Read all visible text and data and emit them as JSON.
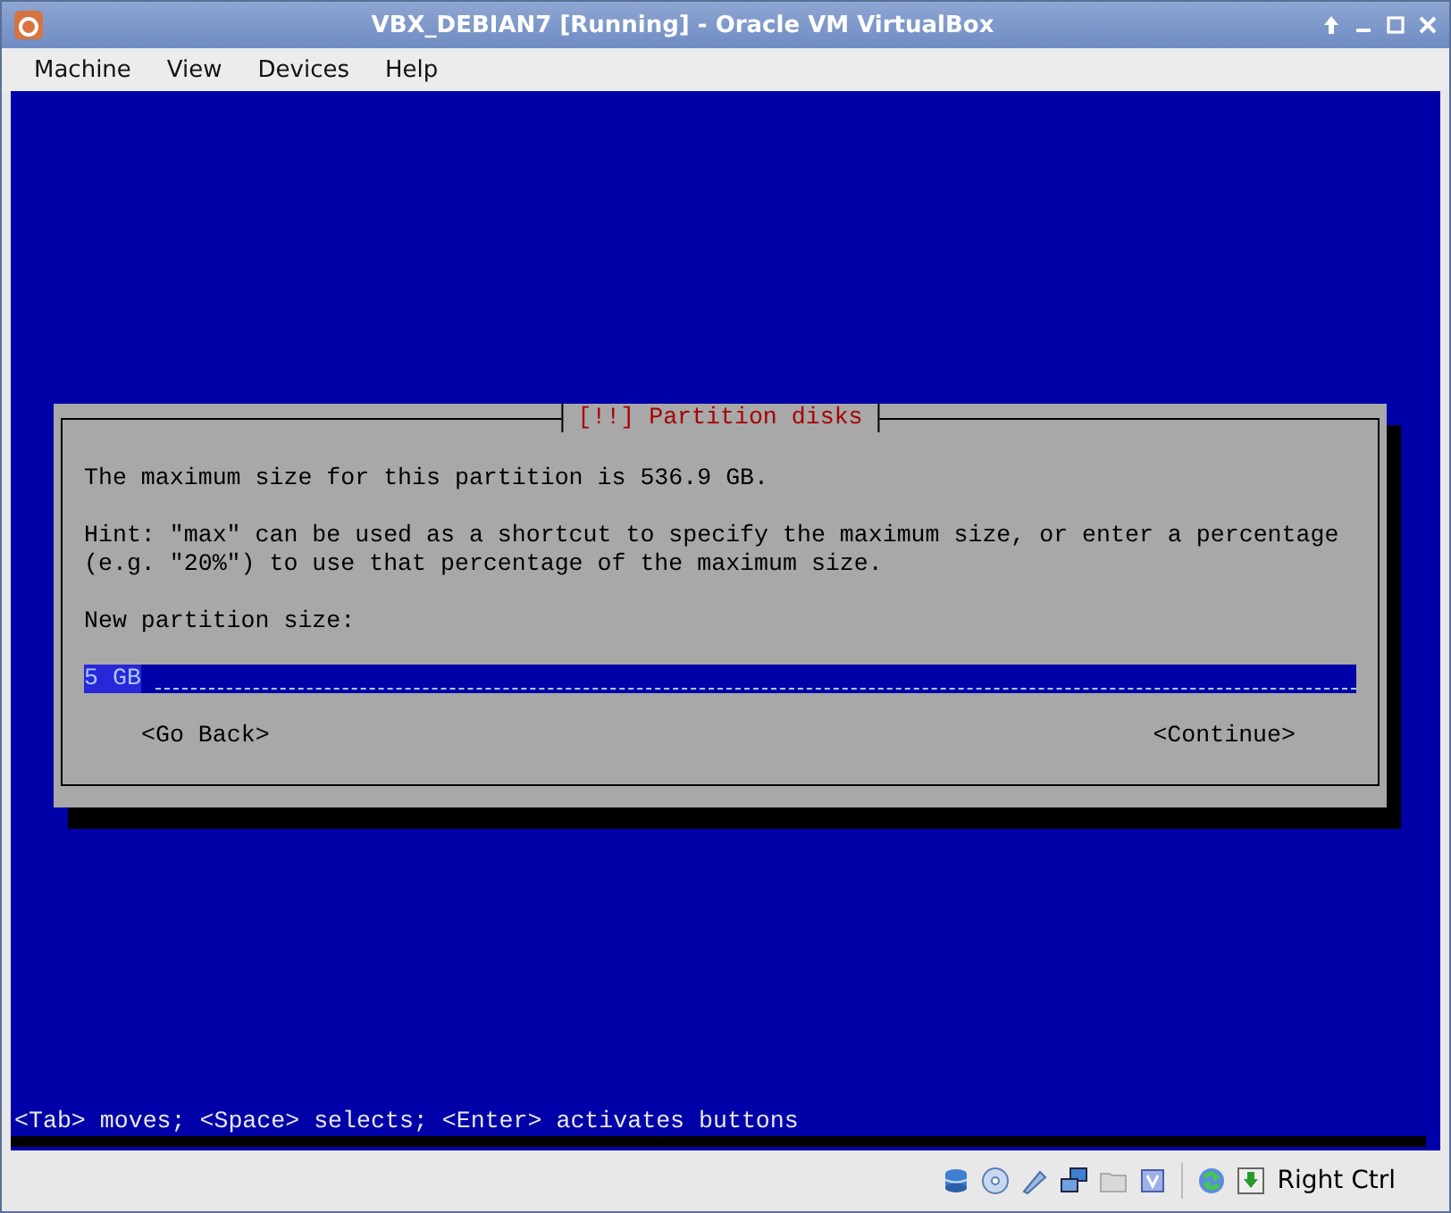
{
  "window": {
    "title": "VBX_DEBIAN7 [Running] - Oracle VM VirtualBox"
  },
  "menu": [
    "Machine",
    "View",
    "Devices",
    "Help"
  ],
  "dialog": {
    "title": "[!!] Partition disks",
    "paragraphs": [
      "The maximum size for this partition is 536.9 GB.",
      "Hint: \"max\" can be used as a shortcut to specify the maximum size, or enter a percentage (e.g. \"20%\") to use that percentage of the maximum size.",
      "New partition size:"
    ],
    "field": {
      "value": "5 GB"
    },
    "buttons": [
      {
        "label": "<Go Back>"
      },
      {
        "label": "<Continue>"
      }
    ]
  },
  "help_line": "<Tab> moves; <Space> selects; <Enter> activates buttons",
  "status_bar": {
    "host_key": "Right Ctrl"
  }
}
